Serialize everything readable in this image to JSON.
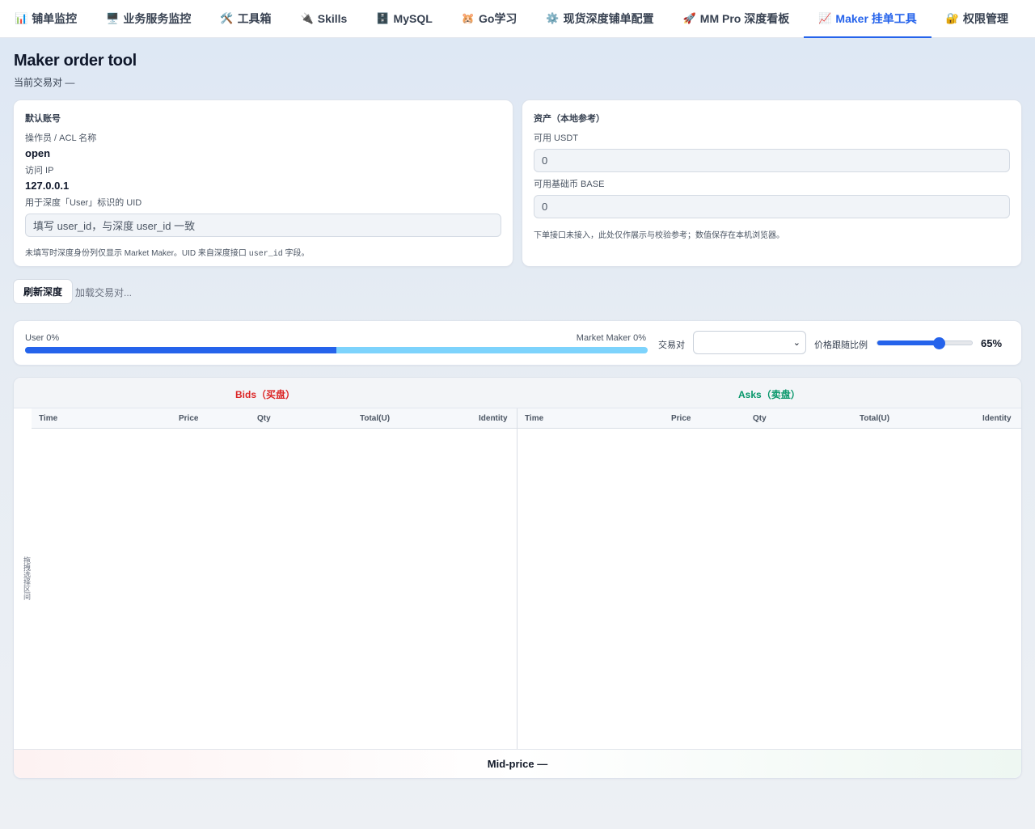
{
  "nav": {
    "tabs": [
      {
        "icon": "📊",
        "label": "铺单监控"
      },
      {
        "icon": "🖥️",
        "label": "业务服务监控"
      },
      {
        "icon": "🛠️",
        "label": "工具箱"
      },
      {
        "icon": "🔌",
        "label": "Skills"
      },
      {
        "icon": "🗄️",
        "label": "MySQL"
      },
      {
        "icon": "🐹",
        "label": "Go学习"
      },
      {
        "icon": "⚙️",
        "label": "现货深度铺单配置"
      },
      {
        "icon": "🚀",
        "label": "MM Pro 深度看板"
      },
      {
        "icon": "📈",
        "label": "Maker 挂单工具"
      },
      {
        "icon": "🔐",
        "label": "权限管理"
      }
    ],
    "active_index": 8
  },
  "page": {
    "title": "Maker order tool",
    "subtitle": "当前交易对 —"
  },
  "account": {
    "title": "默认账号",
    "operator_label": "操作员 / ACL 名称",
    "operator_value": "open",
    "ip_label": "访问 IP",
    "ip_value": "127.0.0.1",
    "uid_label": "用于深度「User」标识的 UID",
    "uid_placeholder": "填写 user_id，与深度 user_id 一致",
    "note_prefix": "未填写时深度身份列仅显示 Market Maker。UID 来自深度接口 ",
    "note_code": "user_id",
    "note_suffix": " 字段。"
  },
  "assets": {
    "title": "资产（本地参考）",
    "usdt_label": "可用 USDT",
    "usdt_value": "0",
    "base_label": "可用基础币 BASE",
    "base_value": "0",
    "note": "下单接口未接入，此处仅作展示与校验参考；数值保存在本机浏览器。"
  },
  "toolbar": {
    "refresh_label": "刷新深度",
    "loading_text": "加载交易对..."
  },
  "ratio": {
    "user_label": "User 0%",
    "mm_label": "Market Maker 0%",
    "user_fraction": 0.5,
    "pair_label": "交易对",
    "pair_value": "",
    "follow_label": "价格跟随比例",
    "follow_value": 65,
    "follow_text": "65%"
  },
  "book": {
    "bids_title": "Bids（买盘）",
    "asks_title": "Asks（卖盘）",
    "columns": [
      "Time",
      "Price",
      "Qty",
      "Total(U)",
      "Identity"
    ],
    "drag_hint": "拖拽选择区间",
    "mid_price": "Mid-price —"
  },
  "colors": {
    "accent": "#2563eb",
    "bids": "#dc2626",
    "asks": "#059669",
    "mm_bar": "#7dd3fc"
  }
}
